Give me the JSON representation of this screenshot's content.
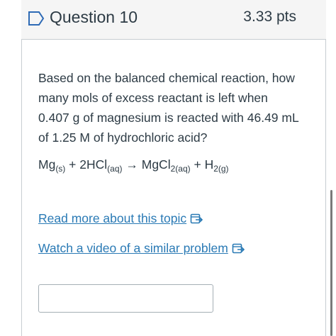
{
  "question": {
    "title": "Question 10",
    "points": "3.33 pts",
    "text": "Based on the balanced chemical reaction, how many mols of excess reactant is left when 0.407 g of magnesium is reacted with 46.49 mL of 1.25 M of hydrochloric acid?"
  },
  "equation": {
    "mg": "Mg",
    "mg_sub": "(s)",
    "plus1": " + ",
    "hcl": "2HCl",
    "hcl_sub": "(aq)",
    "arrow": " → ",
    "mgcl": "MgCl",
    "mgcl_sub": "2(aq)",
    "plus2": " + ",
    "h2": "H",
    "h2_sub": "2(g)"
  },
  "links": {
    "read_more": "Read more about this topic",
    "watch_video": "Watch a video of a similar problem"
  },
  "answer": {
    "value": ""
  },
  "colors": {
    "link": "#2a7ab5",
    "flag": "#2d6ab5",
    "header_bg": "#f5f5f5",
    "border": "#c7cdd1"
  },
  "icons": {
    "flag": "bookmark-flag-icon",
    "external": "external-link-icon"
  }
}
